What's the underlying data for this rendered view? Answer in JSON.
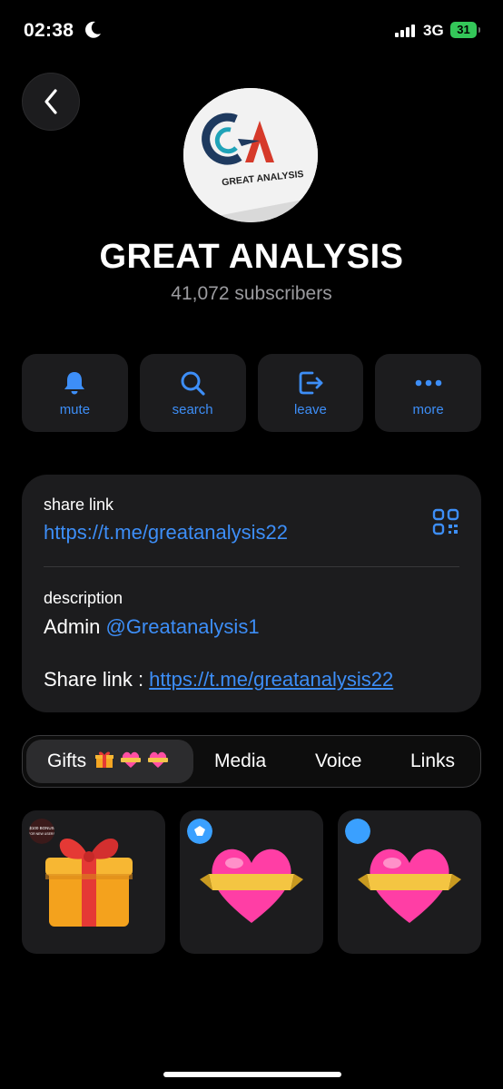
{
  "status_bar": {
    "time": "02:38",
    "network": "3G",
    "battery": "31"
  },
  "channel": {
    "logo_text": "GREAT ANALYSIS",
    "name": "GREAT ANALYSIS",
    "subscribers": "41,072 subscribers"
  },
  "actions": [
    {
      "label": "mute",
      "icon": "bell-icon"
    },
    {
      "label": "search",
      "icon": "search-icon"
    },
    {
      "label": "leave",
      "icon": "leave-icon"
    },
    {
      "label": "more",
      "icon": "more-icon"
    }
  ],
  "info": {
    "share_link_label": "share link",
    "share_link_url": "https://t.me/greatanalysis22",
    "description_label": "description",
    "description_prefix": "Admin ",
    "description_mention": "@Greatanalysis1",
    "description_share_prefix": "Share link : ",
    "description_share_url": "https://t.me/greatanalysis22"
  },
  "tabs": [
    {
      "label": "Gifts",
      "active": true
    },
    {
      "label": "Media"
    },
    {
      "label": "Voice"
    },
    {
      "label": "Links"
    }
  ],
  "gifts": [
    {
      "name": "gift-box",
      "badge_text": "$100 BONUS FOR NEW USERS"
    },
    {
      "name": "heart-ribbon"
    },
    {
      "name": "heart-ribbon"
    }
  ],
  "colors": {
    "accent": "#3d8ef7",
    "card": "#1c1c1e",
    "background": "#000000"
  }
}
